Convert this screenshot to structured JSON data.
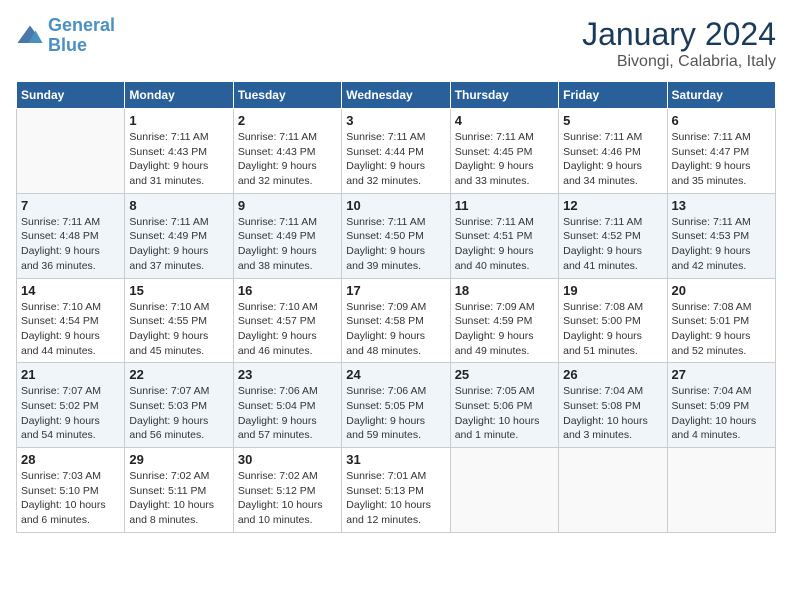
{
  "header": {
    "logo_general": "General",
    "logo_blue": "Blue",
    "month": "January 2024",
    "location": "Bivongi, Calabria, Italy"
  },
  "days_of_week": [
    "Sunday",
    "Monday",
    "Tuesday",
    "Wednesday",
    "Thursday",
    "Friday",
    "Saturday"
  ],
  "weeks": [
    [
      {
        "day": "",
        "info": ""
      },
      {
        "day": "1",
        "info": "Sunrise: 7:11 AM\nSunset: 4:43 PM\nDaylight: 9 hours\nand 31 minutes."
      },
      {
        "day": "2",
        "info": "Sunrise: 7:11 AM\nSunset: 4:43 PM\nDaylight: 9 hours\nand 32 minutes."
      },
      {
        "day": "3",
        "info": "Sunrise: 7:11 AM\nSunset: 4:44 PM\nDaylight: 9 hours\nand 32 minutes."
      },
      {
        "day": "4",
        "info": "Sunrise: 7:11 AM\nSunset: 4:45 PM\nDaylight: 9 hours\nand 33 minutes."
      },
      {
        "day": "5",
        "info": "Sunrise: 7:11 AM\nSunset: 4:46 PM\nDaylight: 9 hours\nand 34 minutes."
      },
      {
        "day": "6",
        "info": "Sunrise: 7:11 AM\nSunset: 4:47 PM\nDaylight: 9 hours\nand 35 minutes."
      }
    ],
    [
      {
        "day": "7",
        "info": "Sunrise: 7:11 AM\nSunset: 4:48 PM\nDaylight: 9 hours\nand 36 minutes."
      },
      {
        "day": "8",
        "info": "Sunrise: 7:11 AM\nSunset: 4:49 PM\nDaylight: 9 hours\nand 37 minutes."
      },
      {
        "day": "9",
        "info": "Sunrise: 7:11 AM\nSunset: 4:49 PM\nDaylight: 9 hours\nand 38 minutes."
      },
      {
        "day": "10",
        "info": "Sunrise: 7:11 AM\nSunset: 4:50 PM\nDaylight: 9 hours\nand 39 minutes."
      },
      {
        "day": "11",
        "info": "Sunrise: 7:11 AM\nSunset: 4:51 PM\nDaylight: 9 hours\nand 40 minutes."
      },
      {
        "day": "12",
        "info": "Sunrise: 7:11 AM\nSunset: 4:52 PM\nDaylight: 9 hours\nand 41 minutes."
      },
      {
        "day": "13",
        "info": "Sunrise: 7:11 AM\nSunset: 4:53 PM\nDaylight: 9 hours\nand 42 minutes."
      }
    ],
    [
      {
        "day": "14",
        "info": "Sunrise: 7:10 AM\nSunset: 4:54 PM\nDaylight: 9 hours\nand 44 minutes."
      },
      {
        "day": "15",
        "info": "Sunrise: 7:10 AM\nSunset: 4:55 PM\nDaylight: 9 hours\nand 45 minutes."
      },
      {
        "day": "16",
        "info": "Sunrise: 7:10 AM\nSunset: 4:57 PM\nDaylight: 9 hours\nand 46 minutes."
      },
      {
        "day": "17",
        "info": "Sunrise: 7:09 AM\nSunset: 4:58 PM\nDaylight: 9 hours\nand 48 minutes."
      },
      {
        "day": "18",
        "info": "Sunrise: 7:09 AM\nSunset: 4:59 PM\nDaylight: 9 hours\nand 49 minutes."
      },
      {
        "day": "19",
        "info": "Sunrise: 7:08 AM\nSunset: 5:00 PM\nDaylight: 9 hours\nand 51 minutes."
      },
      {
        "day": "20",
        "info": "Sunrise: 7:08 AM\nSunset: 5:01 PM\nDaylight: 9 hours\nand 52 minutes."
      }
    ],
    [
      {
        "day": "21",
        "info": "Sunrise: 7:07 AM\nSunset: 5:02 PM\nDaylight: 9 hours\nand 54 minutes."
      },
      {
        "day": "22",
        "info": "Sunrise: 7:07 AM\nSunset: 5:03 PM\nDaylight: 9 hours\nand 56 minutes."
      },
      {
        "day": "23",
        "info": "Sunrise: 7:06 AM\nSunset: 5:04 PM\nDaylight: 9 hours\nand 57 minutes."
      },
      {
        "day": "24",
        "info": "Sunrise: 7:06 AM\nSunset: 5:05 PM\nDaylight: 9 hours\nand 59 minutes."
      },
      {
        "day": "25",
        "info": "Sunrise: 7:05 AM\nSunset: 5:06 PM\nDaylight: 10 hours\nand 1 minute."
      },
      {
        "day": "26",
        "info": "Sunrise: 7:04 AM\nSunset: 5:08 PM\nDaylight: 10 hours\nand 3 minutes."
      },
      {
        "day": "27",
        "info": "Sunrise: 7:04 AM\nSunset: 5:09 PM\nDaylight: 10 hours\nand 4 minutes."
      }
    ],
    [
      {
        "day": "28",
        "info": "Sunrise: 7:03 AM\nSunset: 5:10 PM\nDaylight: 10 hours\nand 6 minutes."
      },
      {
        "day": "29",
        "info": "Sunrise: 7:02 AM\nSunset: 5:11 PM\nDaylight: 10 hours\nand 8 minutes."
      },
      {
        "day": "30",
        "info": "Sunrise: 7:02 AM\nSunset: 5:12 PM\nDaylight: 10 hours\nand 10 minutes."
      },
      {
        "day": "31",
        "info": "Sunrise: 7:01 AM\nSunset: 5:13 PM\nDaylight: 10 hours\nand 12 minutes."
      },
      {
        "day": "",
        "info": ""
      },
      {
        "day": "",
        "info": ""
      },
      {
        "day": "",
        "info": ""
      }
    ]
  ]
}
